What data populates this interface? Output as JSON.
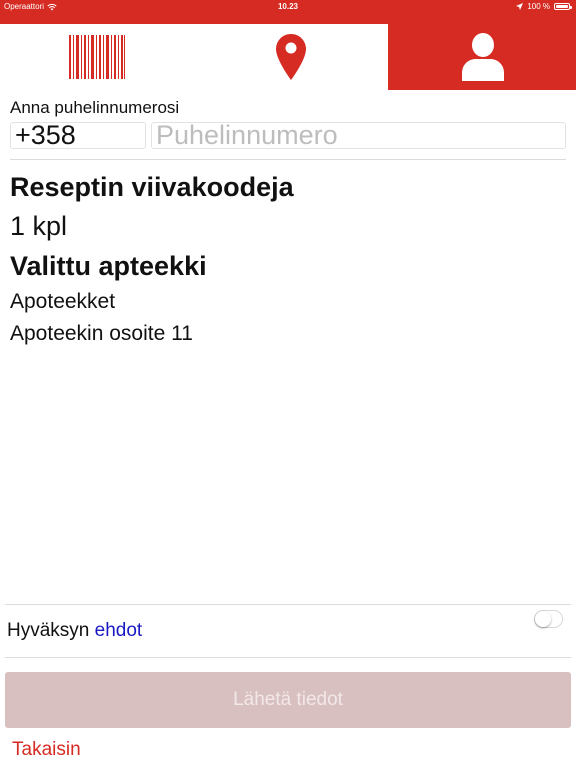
{
  "status_bar": {
    "carrier": "Operaattori",
    "time": "10.23",
    "battery": "100 %",
    "battery_level": 1.0,
    "icons": [
      "wifi-icon",
      "location-arrow-icon",
      "battery-icon"
    ]
  },
  "tabs": [
    {
      "id": "barcode",
      "icon": "barcode-icon"
    },
    {
      "id": "location",
      "icon": "map-pin-icon"
    },
    {
      "id": "profile",
      "icon": "user-icon",
      "active": true
    }
  ],
  "phone": {
    "label": "Anna puhelinnumerosi",
    "prefix": "+358",
    "placeholder": "Puhelinnumero",
    "number": ""
  },
  "prescription": {
    "heading": "Reseptin viivakoodeja",
    "count": "1 kpl"
  },
  "pharmacy": {
    "heading": "Valittu apteekki",
    "name": "Apoteekket",
    "address": "Apoteekin osoite 11"
  },
  "terms": {
    "text": "Hyväksyn",
    "link": "ehdot",
    "accepted": false
  },
  "submit_label": "Lähetä tiedot",
  "back_label": "Takaisin",
  "colors": {
    "brand": "#d62b23",
    "link": "#1a1ac4",
    "disabled_button": "#d9c0c0"
  }
}
